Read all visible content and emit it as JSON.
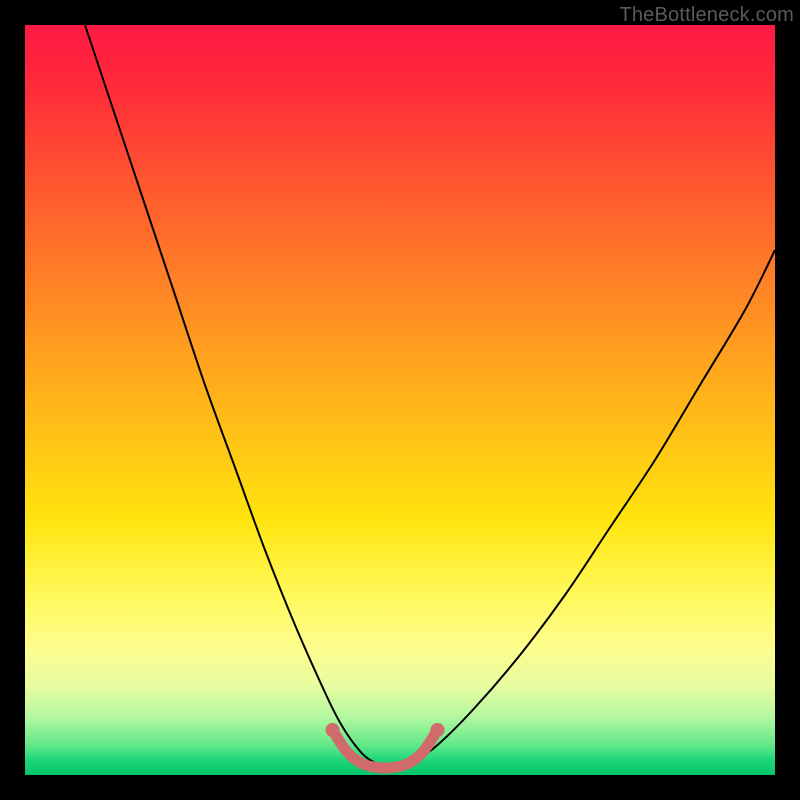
{
  "watermark": "TheBottleneck.com",
  "chart_data": {
    "type": "line",
    "title": "",
    "xlabel": "",
    "ylabel": "",
    "xlim": [
      0,
      100
    ],
    "ylim": [
      0,
      100
    ],
    "series": [
      {
        "name": "bottleneck-curve",
        "color": "#000000",
        "x": [
          8,
          12,
          16,
          20,
          24,
          28,
          32,
          36,
          40,
          42,
          44,
          46,
          49,
          52,
          55,
          60,
          66,
          72,
          78,
          84,
          90,
          96,
          100
        ],
        "values": [
          100,
          88,
          76,
          64,
          52,
          41,
          30,
          20,
          11,
          7,
          4,
          2,
          1,
          2,
          4,
          9,
          16,
          24,
          33,
          42,
          52,
          62,
          70
        ]
      },
      {
        "name": "optimal-band-marker",
        "color": "#d16a6a",
        "x": [
          41,
          43,
          45,
          47,
          49,
          51,
          53,
          55
        ],
        "values": [
          6,
          3,
          1.5,
          1,
          1,
          1.5,
          3,
          6
        ]
      }
    ],
    "background_gradient": {
      "top": "#ff1a44",
      "mid": "#ffe40e",
      "bottom": "#04c46b"
    }
  }
}
